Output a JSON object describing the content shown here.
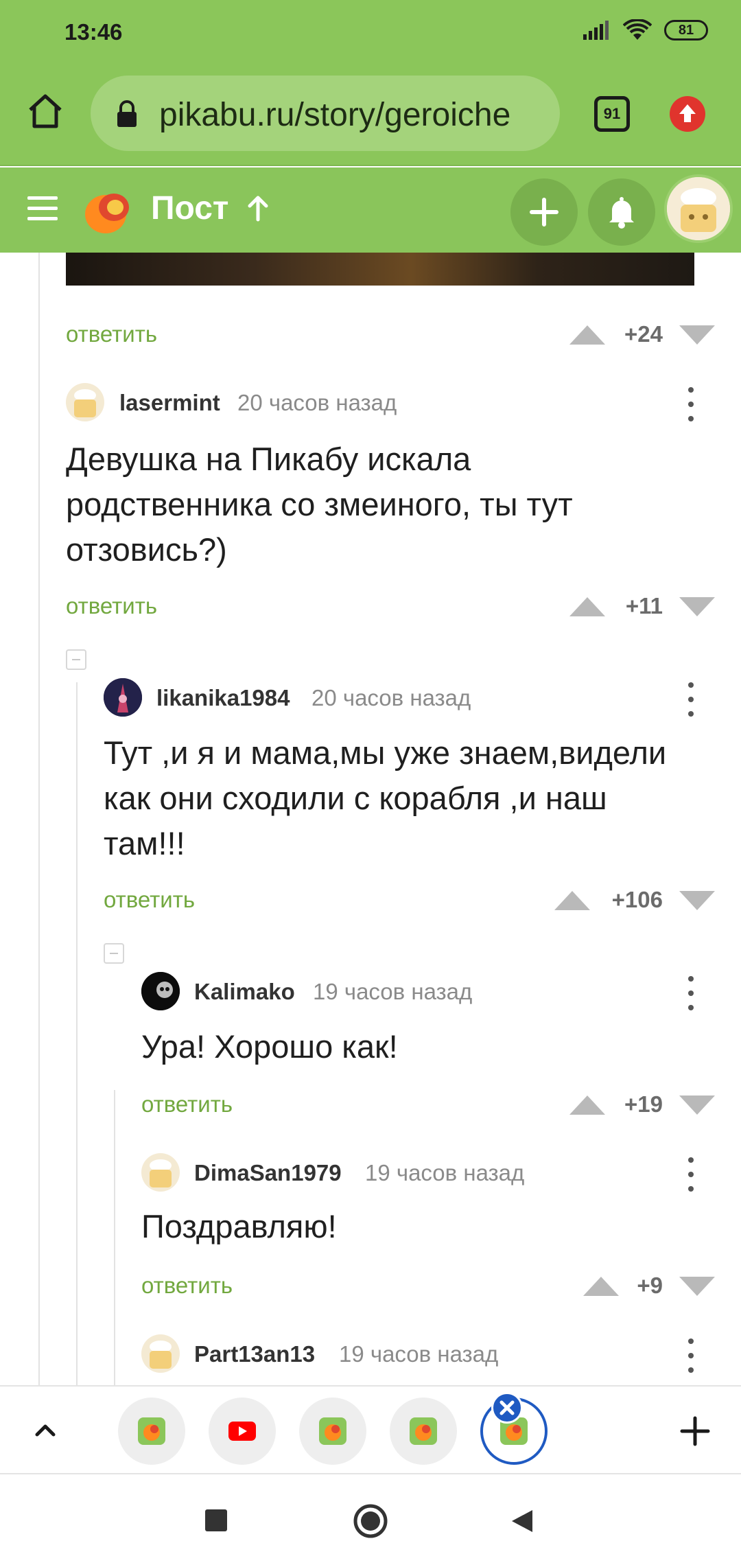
{
  "status_bar": {
    "time": "13:46",
    "battery": "81"
  },
  "browser": {
    "url": "pikabu.ru/story/geroiche",
    "tabs_count": "91"
  },
  "header": {
    "title": "Пост"
  },
  "reply_label": "ответить",
  "top_comment_votes": "+24",
  "comments": [
    {
      "author": "lasermint",
      "time": "20 часов назад",
      "lines": [
        "Девушка на Пикабу искала",
        "родственника со змеиного, ты тут",
        "отзовись?)"
      ],
      "votes": "+11"
    },
    {
      "author": "likanika1984",
      "time": "20 часов назад",
      "lines": [
        "Тут ,и я и мама,мы уже знаем,видели",
        "как они сходили с корабля ,и наш",
        "там!!!"
      ],
      "votes": "+106"
    },
    {
      "author": "Kalimako",
      "time": "19 часов назад",
      "lines": [
        "Ура! Хорошо как!"
      ],
      "votes": "+19"
    },
    {
      "author": "DimaSan1979",
      "time": "19 часов назад",
      "lines": [
        "Поздравляю!"
      ],
      "votes": "+9"
    },
    {
      "author": "Part13an13",
      "time": "19 часов назад",
      "lines": []
    }
  ],
  "icons": {
    "home": "home-icon",
    "lock": "lock-icon",
    "update": "arrow-up-icon",
    "menu": "menu-icon",
    "logo": "pikabu-logo",
    "add": "plus-icon",
    "bell": "bell-icon",
    "more": "kebab-icon",
    "caret": "chevron-up-icon",
    "youtube": "youtube-icon",
    "stop": "square-icon",
    "recents": "circle-icon",
    "back": "triangle-back-icon"
  },
  "colors": {
    "brand_green": "#8bc65a",
    "link_green": "#72a83f",
    "vote_grey": "#b9b9b9",
    "active_tab_blue": "#1f5ac2"
  }
}
